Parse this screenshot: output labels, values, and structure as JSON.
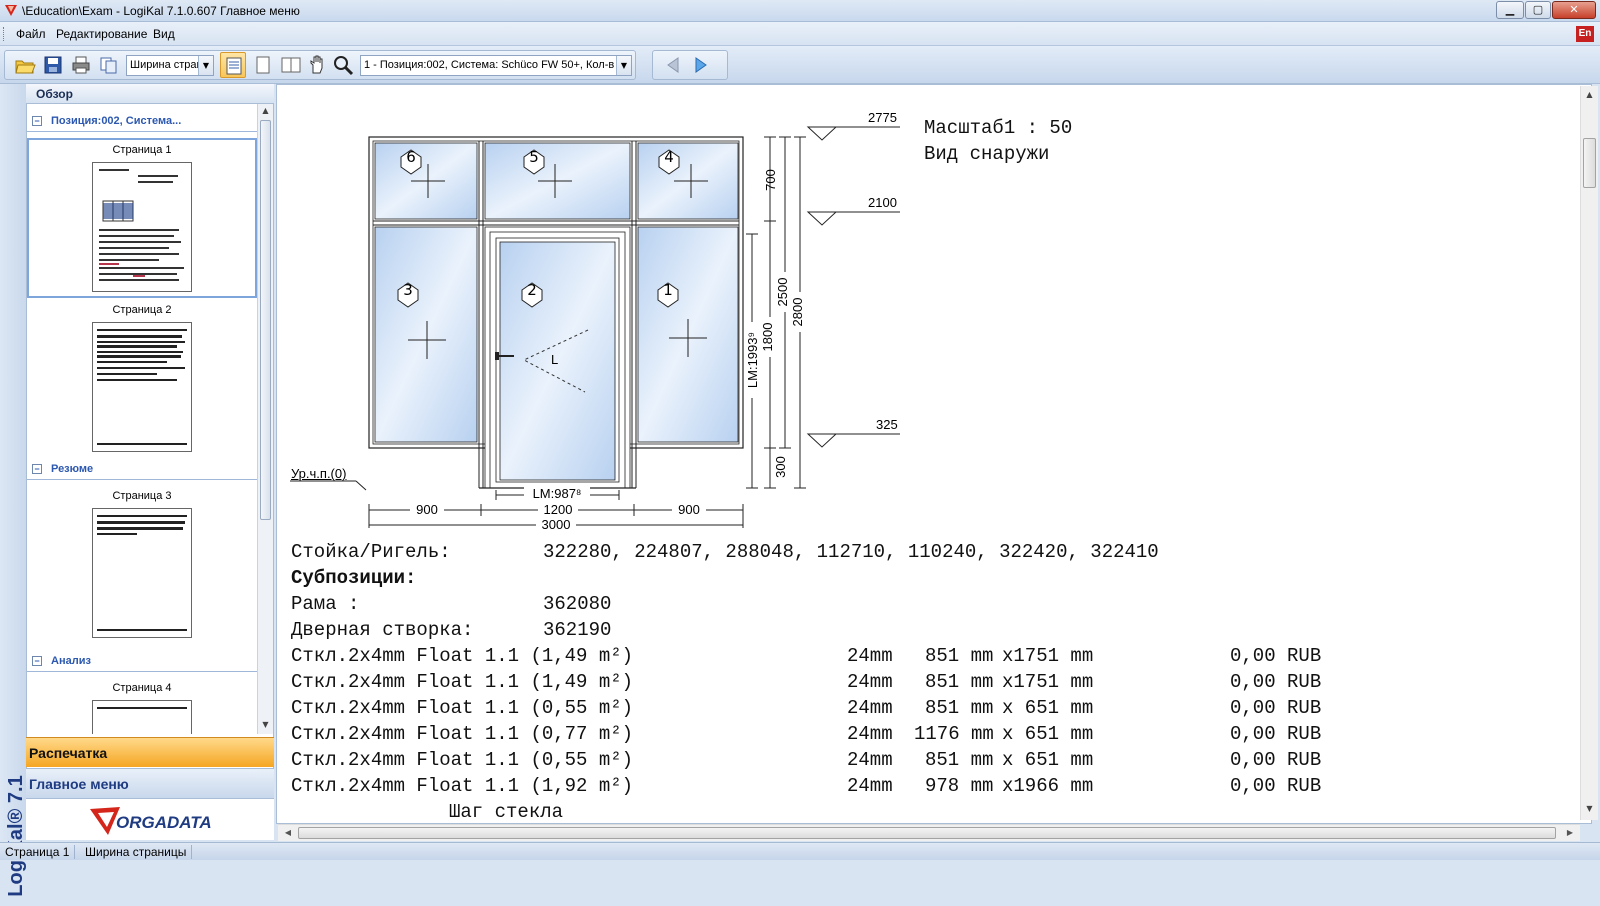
{
  "window": {
    "title": "\\Education\\Exam - LogiKal 7.1.0.607 Главное меню",
    "minimize": "▁",
    "maximize": "▢",
    "close": "✕"
  },
  "menu": {
    "file": "Файл",
    "edit": "Редактирование",
    "view": "Вид",
    "lang": "En"
  },
  "toolbar": {
    "zoom_select": "Ширина страни",
    "position_select": "1 - Позиция:002, Система: Schüco FW 50+, Кол-в"
  },
  "brand": {
    "vertical_text": "LogiKal® 7.1"
  },
  "left_panel": {
    "header": "Обзор",
    "sections": [
      {
        "title": "Позиция:002, Система...",
        "pages": [
          "Страница 1",
          "Страница 2"
        ]
      },
      {
        "title": "Резюме",
        "pages": [
          "Страница 3"
        ]
      },
      {
        "title": "Анализ",
        "pages": [
          "Страница 4"
        ]
      }
    ],
    "toggle": "−",
    "nav_print": "Распечатка",
    "nav_main": "Главное меню",
    "orgadata": "ORGADATA"
  },
  "drawing": {
    "scale": "Масштаб1 : 50",
    "view": "Вид снаружи",
    "level_2775": "2775",
    "level_2100": "2100",
    "level_325": "325",
    "dim_700": "700",
    "dim_1800": "1800",
    "dim_2500": "2500",
    "dim_2800": "2800",
    "dim_300": "300",
    "dim_lm_vert": "LM:1993⁹",
    "dim_lm_horiz": "LM:987⁸",
    "dim_900_left": "900",
    "dim_1200": "1200",
    "dim_900_right": "900",
    "dim_3000": "3000",
    "floor_label": "Ур.ч.п.(0)",
    "door_swing": "L",
    "fields": [
      "1",
      "2",
      "3",
      "4",
      "5",
      "6"
    ]
  },
  "report": {
    "profiles_label": "Стойка/Ригель:",
    "profiles_value": "322280, 224807, 288048, 112710, 110240, 322420, 322410",
    "subpositions": "Субпозиции:",
    "frame_label": "Рама :",
    "frame_value": "362080",
    "door_label": "Дверная створка:",
    "door_value": "362190",
    "glass_rows": [
      {
        "name": "Сткл.2x4mm Float 1.1 (1,49 m²)",
        "thick": "24mm",
        "w": "851 mm",
        "h": "x1751 mm",
        "price": "0,00 RUB"
      },
      {
        "name": "Сткл.2x4mm Float 1.1 (1,49 m²)",
        "thick": "24mm",
        "w": "851 mm",
        "h": "x1751 mm",
        "price": "0,00 RUB"
      },
      {
        "name": "Сткл.2x4mm Float 1.1 (0,55 m²)",
        "thick": "24mm",
        "w": "851 mm",
        "h": "x 651 mm",
        "price": "0,00 RUB"
      },
      {
        "name": "Сткл.2x4mm Float 1.1 (0,77 m²)",
        "thick": "24mm",
        "w": "1176 mm",
        "h": "x 651 mm",
        "price": "0,00 RUB"
      },
      {
        "name": "Сткл.2x4mm Float 1.1 (0,55 m²)",
        "thick": "24mm",
        "w": "851 mm",
        "h": "x 651 mm",
        "price": "0,00 RUB"
      },
      {
        "name": "Сткл.2x4mm Float 1.1 (1,92 m²)",
        "thick": "24mm",
        "w": "978 mm",
        "h": "x1966 mm",
        "price": "0,00 RUB"
      }
    ],
    "glass_pitch": "Шаг стекла"
  },
  "status": {
    "page": "Страница 1",
    "zoom": "Ширина страницы"
  },
  "colors": {
    "accent_orange": "#f5a623",
    "brand_blue": "#1f3b82",
    "link_blue": "#2c58b0",
    "glass_blue": "#c6dcf4"
  }
}
